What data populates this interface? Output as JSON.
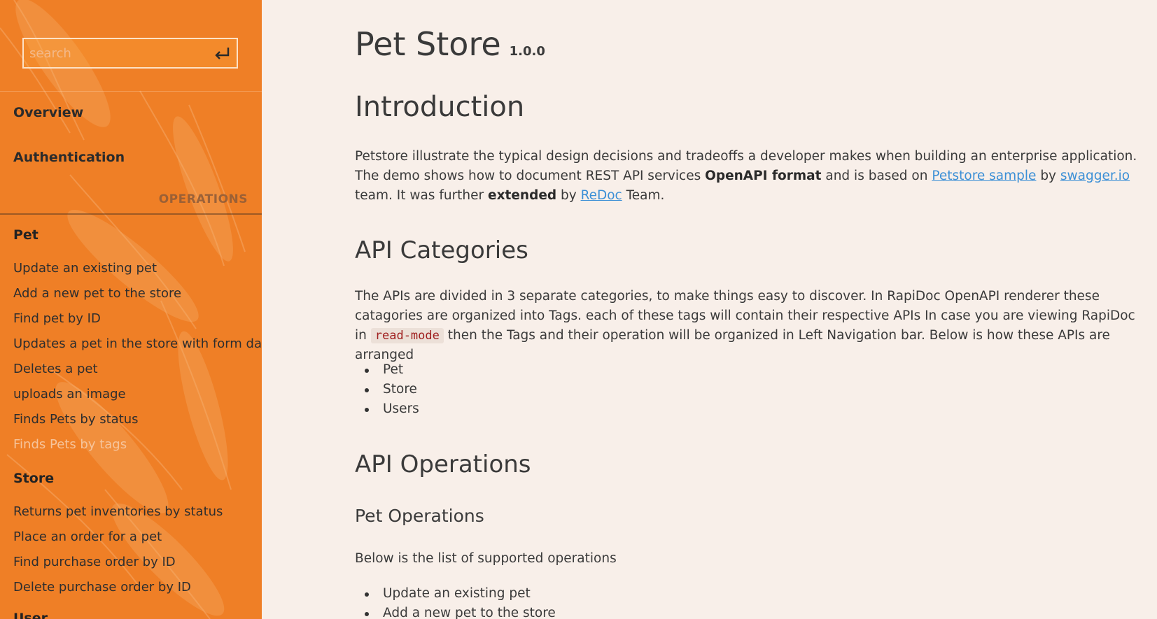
{
  "sidebar": {
    "search_placeholder": "search",
    "overview": "Overview",
    "authentication": "Authentication",
    "operations_label": "OPERATIONS",
    "groups": [
      {
        "name": "Pet",
        "items": [
          "Update an existing pet",
          "Add a new pet to the store",
          "Find pet by ID",
          "Updates a pet in the store with form data",
          "Deletes a pet",
          "uploads an image",
          "Finds Pets by status",
          "Finds Pets by tags"
        ]
      },
      {
        "name": "Store",
        "items": [
          "Returns pet inventories by status",
          "Place an order for a pet",
          "Find purchase order by ID",
          "Delete purchase order by ID"
        ]
      },
      {
        "name": "User"
      }
    ]
  },
  "main": {
    "title": "Pet Store",
    "version": "1.0.0",
    "intro": {
      "heading": "Introduction",
      "p1": "Petstore illustrate the typical design decisions and tradeoffs a developer makes when building an enterprise application. The demo shows how to document REST API services ",
      "p_bold1": "OpenAPI format",
      "p2": " and is based on ",
      "link1": "Petstore sample",
      "p3": " by ",
      "link2": "swagger.io",
      "p4": " team. It was further ",
      "p_bold2": "extended",
      "p5": " by ",
      "link3": "ReDoc",
      "p6": " Team."
    },
    "categories": {
      "heading": "API Categories",
      "p1": "The APIs are divided in 3 separate categories, to make things easy to discover. In RapiDoc OpenAPI renderer these catagories are organized into Tags. each of these tags will contain their respective APIs In case you are viewing RapiDoc in ",
      "code": "read-mode",
      "p2": " then the Tags and their operation will be organized in Left Navigation bar. Below is how these APIs are arranged",
      "list": [
        "Pet",
        "Store",
        "Users"
      ]
    },
    "operations": {
      "heading": "API Operations",
      "subheading": "Pet Operations",
      "p": "Below is the list of supported operations",
      "list": [
        "Update an existing pet",
        "Add a new pet to the store"
      ]
    }
  },
  "colors": {
    "sidebar_bg": "#ef7f26",
    "main_bg": "#f8efe9",
    "link": "#3b8fd6",
    "code_text": "#a02020"
  }
}
